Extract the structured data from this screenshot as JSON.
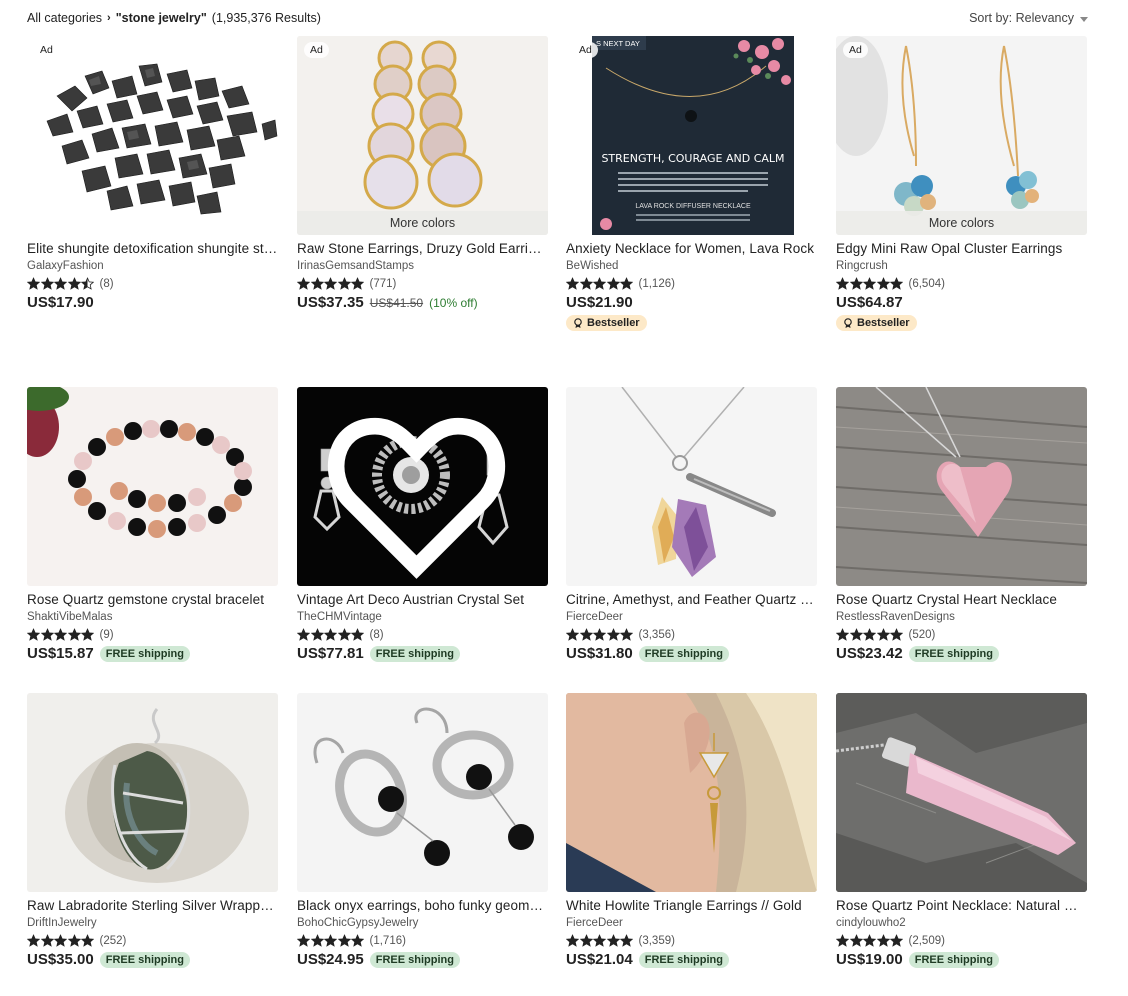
{
  "breadcrumb": {
    "root": "All categories",
    "query": "\"stone jewelry\"",
    "count": "(1,935,376 Results)"
  },
  "sort": {
    "label": "Sort by: Relevancy"
  },
  "listings": [
    {
      "title": "Elite shungite detoxification shungite stones",
      "shop": "GalaxyFashion",
      "reviews": "(8)",
      "stars": 4.5,
      "price": "US$17.90",
      "ad": "Ad",
      "image": "shungite-stones"
    },
    {
      "title": "Raw Stone Earrings, Druzy Gold Earrings",
      "shop": "IrinasGemsandStamps",
      "reviews": "(771)",
      "stars": 5,
      "price": "US$37.35",
      "orig_price": "US$41.50",
      "discount": "(10% off)",
      "ad": "Ad",
      "more_colors": "More colors",
      "image": "druzy-earrings"
    },
    {
      "title": "Anxiety Necklace for Women, Lava Rock",
      "shop": "BeWished",
      "reviews": "(1,126)",
      "stars": 5,
      "price": "US$21.90",
      "ad": "Ad",
      "badge": "Bestseller",
      "image": "lava-necklace-card",
      "card_text": {
        "banner": "S NEXT DAY",
        "headline": "STRENGTH, COURAGE AND CALM",
        "product": "LAVA ROCK DIFFUSER NECKLACE"
      }
    },
    {
      "title": "Edgy Mini Raw Opal Cluster Earrings",
      "shop": "Ringcrush",
      "reviews": "(6,504)",
      "stars": 5,
      "price": "US$64.87",
      "ad": "Ad",
      "more_colors": "More colors",
      "badge": "Bestseller",
      "image": "opal-earrings"
    },
    {
      "title": "Rose Quartz gemstone crystal bracelet",
      "shop": "ShaktiVibeMalas",
      "reviews": "(9)",
      "stars": 5,
      "price": "US$15.87",
      "free_shipping": "FREE shipping",
      "image": "bead-bracelet"
    },
    {
      "title": "Vintage Art Deco Austrian Crystal Set",
      "shop": "TheCHMVintage",
      "reviews": "(8)",
      "stars": 5,
      "price": "US$77.81",
      "free_shipping": "FREE shipping",
      "favorite": true,
      "image": "art-deco-set"
    },
    {
      "title": "Citrine, Amethyst, and Feather Quartz Necklace",
      "shop": "FierceDeer",
      "reviews": "(3,356)",
      "stars": 5,
      "price": "US$31.80",
      "free_shipping": "FREE shipping",
      "image": "crystal-feather-necklace"
    },
    {
      "title": "Rose Quartz Crystal Heart Necklace",
      "shop": "RestlessRavenDesigns",
      "reviews": "(520)",
      "stars": 5,
      "price": "US$23.42",
      "free_shipping": "FREE shipping",
      "image": "heart-necklace"
    },
    {
      "title": "Raw Labradorite Sterling Silver Wrapped Pendant",
      "shop": "DriftInJewelry",
      "reviews": "(252)",
      "stars": 5,
      "price": "US$35.00",
      "free_shipping": "FREE shipping",
      "image": "labradorite-pendant"
    },
    {
      "title": "Black onyx earrings, boho funky geometric",
      "shop": "BohoChicGypsyJewelry",
      "reviews": "(1,716)",
      "stars": 5,
      "price": "US$24.95",
      "free_shipping": "FREE shipping",
      "image": "onyx-earrings"
    },
    {
      "title": "White Howlite Triangle Earrings // Gold",
      "shop": "FierceDeer",
      "reviews": "(3,359)",
      "stars": 5,
      "price": "US$21.04",
      "free_shipping": "FREE shipping",
      "image": "howlite-earrings"
    },
    {
      "title": "Rose Quartz Point Necklace: Natural Crystal",
      "shop": "cindylouwho2",
      "reviews": "(2,509)",
      "stars": 5,
      "price": "US$19.00",
      "free_shipping": "FREE shipping",
      "image": "quartz-point-necklace"
    }
  ],
  "colors": {
    "free_shipping_bg": "#cfe8d4",
    "bestseller_bg": "#fde9c8",
    "discount": "#2e7d32"
  }
}
